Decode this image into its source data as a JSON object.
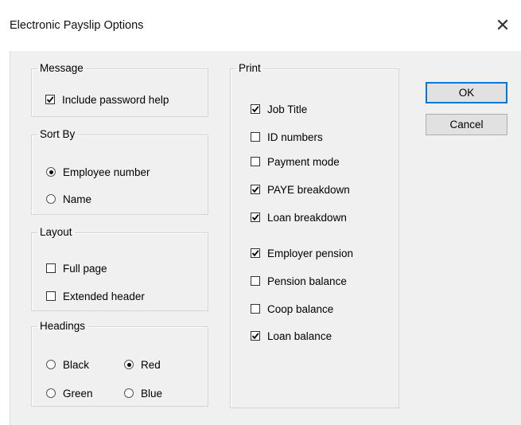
{
  "window": {
    "title": "Electronic Payslip Options",
    "close_glyph": "✕"
  },
  "message": {
    "legend": "Message",
    "include_password_help": {
      "label": "Include password help",
      "checked": true
    }
  },
  "sort_by": {
    "legend": "Sort By",
    "options": [
      {
        "label": "Employee number",
        "selected": true
      },
      {
        "label": "Name",
        "selected": false
      }
    ]
  },
  "layout": {
    "legend": "Layout",
    "options": [
      {
        "label": "Full page",
        "checked": false
      },
      {
        "label": "Extended header",
        "checked": false
      }
    ]
  },
  "headings": {
    "legend": "Headings",
    "options": [
      {
        "label": "Black",
        "selected": false
      },
      {
        "label": "Red",
        "selected": true
      },
      {
        "label": "Green",
        "selected": false
      },
      {
        "label": "Blue",
        "selected": false
      }
    ]
  },
  "print": {
    "legend": "Print",
    "items": [
      {
        "label": "Job Title",
        "checked": true
      },
      {
        "label": "ID numbers",
        "checked": false
      },
      {
        "label": "Payment mode",
        "checked": false
      },
      {
        "label": "PAYE breakdown",
        "checked": true
      },
      {
        "label": "Loan breakdown",
        "checked": true
      },
      {
        "label": "Employer pension",
        "checked": true
      },
      {
        "label": "Pension balance",
        "checked": false
      },
      {
        "label": "Coop balance",
        "checked": false
      },
      {
        "label": "Loan balance",
        "checked": true
      }
    ]
  },
  "buttons": {
    "ok": "OK",
    "cancel": "Cancel"
  },
  "colors": {
    "titlebar": "#ffffff",
    "dialog": "#f0f0f0",
    "default_button_border": "#0078d7"
  }
}
